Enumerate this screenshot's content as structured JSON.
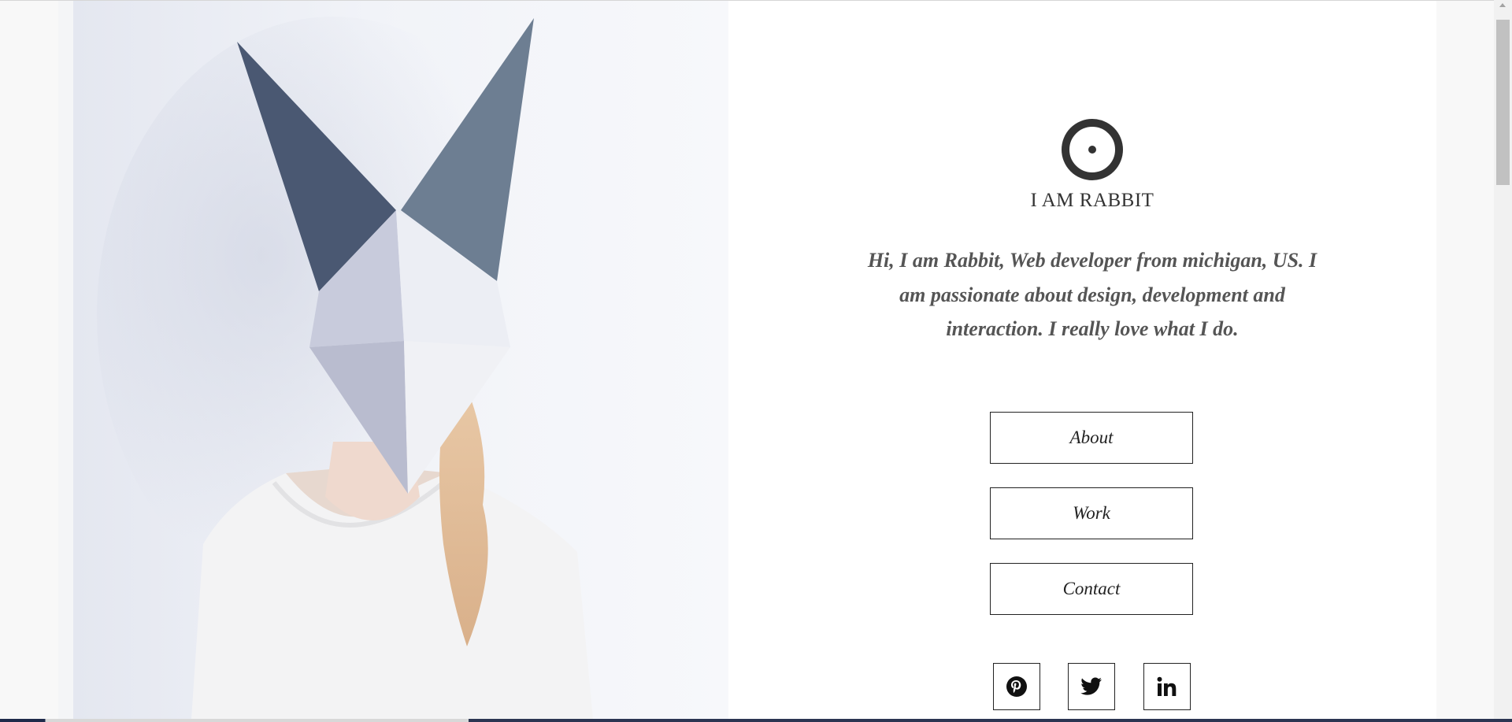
{
  "site": {
    "title": "I AM RABBIT",
    "intro": "Hi, I am Rabbit, Web developer from michigan, US. I am passionate about design, development and interaction. I really love what I do."
  },
  "nav": {
    "about_label": "About",
    "work_label": "Work",
    "contact_label": "Contact"
  },
  "social": [
    {
      "icon": "pinterest-icon"
    },
    {
      "icon": "twitter-icon"
    },
    {
      "icon": "linkedin-icon"
    }
  ],
  "colors": {
    "text_dark": "#333333",
    "text_intro": "#555555",
    "border": "#222222"
  }
}
